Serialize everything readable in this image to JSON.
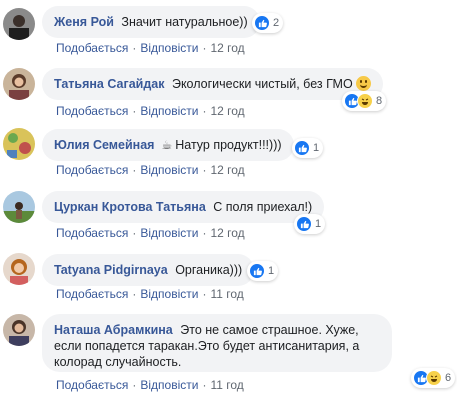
{
  "comments": [
    {
      "author": "Женя Рой",
      "text": "Значит натуральное))",
      "reactions": {
        "icons": [
          "like-icon"
        ],
        "count": "2"
      },
      "actions": {
        "like": "Подобається",
        "reply": "Відповісти",
        "time": "12 год"
      }
    },
    {
      "author": "Татьяна Сагайдак",
      "text": "Экологически чистый, без ГМО",
      "emoji": "smile-emoji",
      "reactions": {
        "icons": [
          "like-icon",
          "haha-icon"
        ],
        "count": "8"
      },
      "actions": {
        "like": "Подобається",
        "reply": "Відповісти",
        "time": "12 год"
      }
    },
    {
      "author": "Юлия Семейная",
      "text": "Натур продукт!!!)))",
      "prefix_icon": "coffee-cup-icon",
      "reactions": {
        "icons": [
          "like-icon"
        ],
        "count": "1"
      },
      "actions": {
        "like": "Подобається",
        "reply": "Відповісти",
        "time": "12 год"
      }
    },
    {
      "author": "Цуркан Кротова Татьяна",
      "text": "С поля приехал!)",
      "reactions": {
        "icons": [
          "like-icon"
        ],
        "count": "1"
      },
      "actions": {
        "like": "Подобається",
        "reply": "Відповісти",
        "time": "12 год"
      }
    },
    {
      "author": "Tatyana Pidgirnaya",
      "text": "Органика)))",
      "reactions": {
        "icons": [
          "like-icon"
        ],
        "count": "1"
      },
      "actions": {
        "like": "Подобається",
        "reply": "Відповісти",
        "time": "11 год"
      }
    },
    {
      "author": "Наташа Абрамкина",
      "text": "Это не самое страшное. Хуже, если попадется таракан.Это будет антисанитария, а колорад случайность.",
      "reactions": {
        "icons": [
          "like-icon",
          "haha-icon"
        ],
        "count": "6"
      },
      "actions": {
        "like": "Подобається",
        "reply": "Відповісти",
        "time": "11 год"
      }
    }
  ],
  "colors": {
    "author": "#385898",
    "bubble": "#f2f3f5",
    "like": "#1877f2",
    "haha": "#f7d14a"
  }
}
